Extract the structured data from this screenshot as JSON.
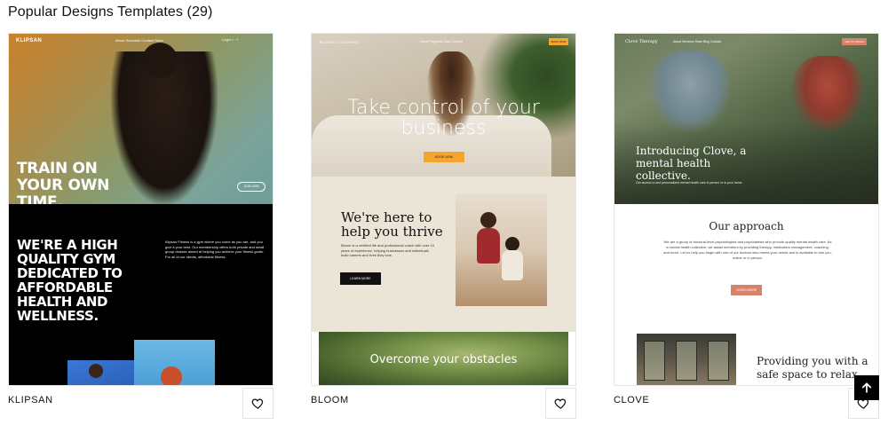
{
  "section": {
    "title": "Popular Designs Templates (29)"
  },
  "templates": [
    {
      "name": "KLIPSAN",
      "preview": {
        "logo": "KLIPSAN",
        "nav": "About  Schedule  Contact  Store",
        "nav_right": "Login  ⌕  ◦  f",
        "headline": "TRAIN ON YOUR OWN TIME.",
        "hero_button": "JOIN NOW",
        "section_headline": "WE'RE A HIGH QUALITY GYM DEDICATED TO AFFORDABLE HEALTH AND WELLNESS.",
        "section_text": "Klipsan Fitness is a gym where you come as you are, and you give it your best. Our membership offers both private and small group classes aimed at helping you achieve your fitness goals. For all of our clients, affordable fitness."
      }
    },
    {
      "name": "BLOOM",
      "preview": {
        "logo": "BLOOM COACHING",
        "nav": "Home   Programs   Shop   Contact",
        "nav_button": "BOOK NOW",
        "hero_title": "Take control of your business",
        "hero_button": "BOOK NOW",
        "mid_title": "We're here to help you thrive",
        "mid_text": "Bloom is a certified life and professional coach with over 10 years of experience, helping businesses and individuals build careers and lives they love.",
        "mid_button": "LEARN MORE",
        "bottom_title": "Overcome your obstacles"
      }
    },
    {
      "name": "CLOVE",
      "preview": {
        "logo": "Clove Therapy",
        "nav": "About   Services   Team   Blog   Contact",
        "nav_button": "GET IN TOUCH",
        "hero_title": "Introducing Clove, a mental health collective.",
        "hero_sub": "Get access to and personalized mental health care in person or in your home.",
        "approach_title": "Our approach",
        "approach_text": "We are a group of doctoral-level psychologists and psychiatrists who provide quality mental health care. As a mental health collective, we assist members by providing therapy, medication management, coaching, and more. Let us help you begin with one of our doctors who meets your needs and is available to see you, online or in person.",
        "approach_button": "LEARN MORE",
        "feature_title": "Providing you with a safe space to relax"
      }
    }
  ],
  "icons": {
    "favorite": "heart-outline-icon",
    "scroll_top": "arrow-up-icon"
  }
}
